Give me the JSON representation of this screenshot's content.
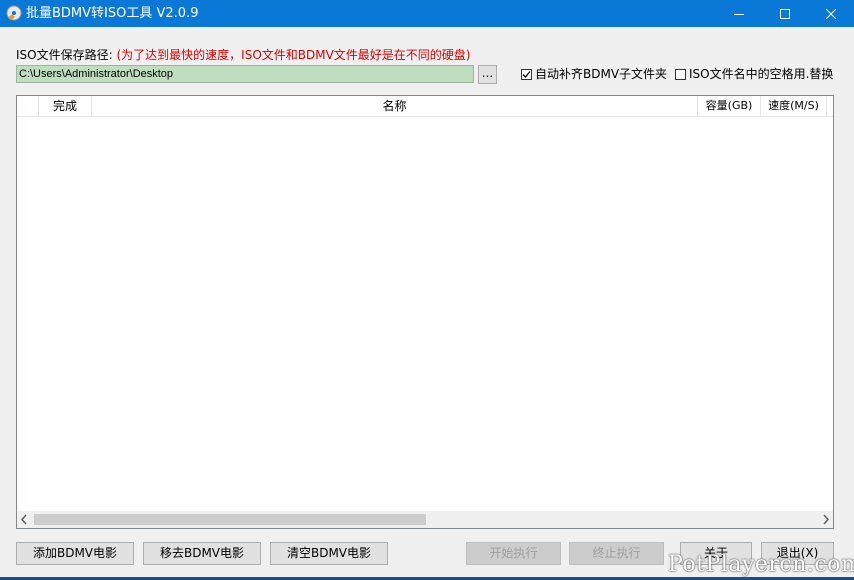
{
  "window": {
    "title": "批量BDMV转ISO工具 V2.0.9",
    "icon": "app-disc-icon",
    "titlebar_color": "#0a78d7"
  },
  "path": {
    "label": "ISO文件保存路径:",
    "note": "(为了达到最快的速度，ISO文件和BDMV文件最好是在不同的硬盘)",
    "value": "C:\\Users\\Administrator\\Desktop",
    "browse_label": "...",
    "input_bg": "#bfddbf"
  },
  "options": {
    "auto_fill": {
      "label": "自动补齐BDMV子文件夹",
      "checked": true
    },
    "replace_spaces": {
      "label": "ISO文件名中的空格用.替换",
      "checked": false
    }
  },
  "list": {
    "columns": [
      "",
      "完成",
      "名称",
      "容量(GB)",
      "速度(M/S)"
    ],
    "rows": []
  },
  "buttons": {
    "add": "添加BDMV电影",
    "remove": "移去BDMV电影",
    "clear": "清空BDMV电影",
    "start": "开始执行",
    "stop": "终止执行",
    "about": "关于",
    "exit": "退出(X)"
  },
  "watermark": "PotPlayercn.com"
}
